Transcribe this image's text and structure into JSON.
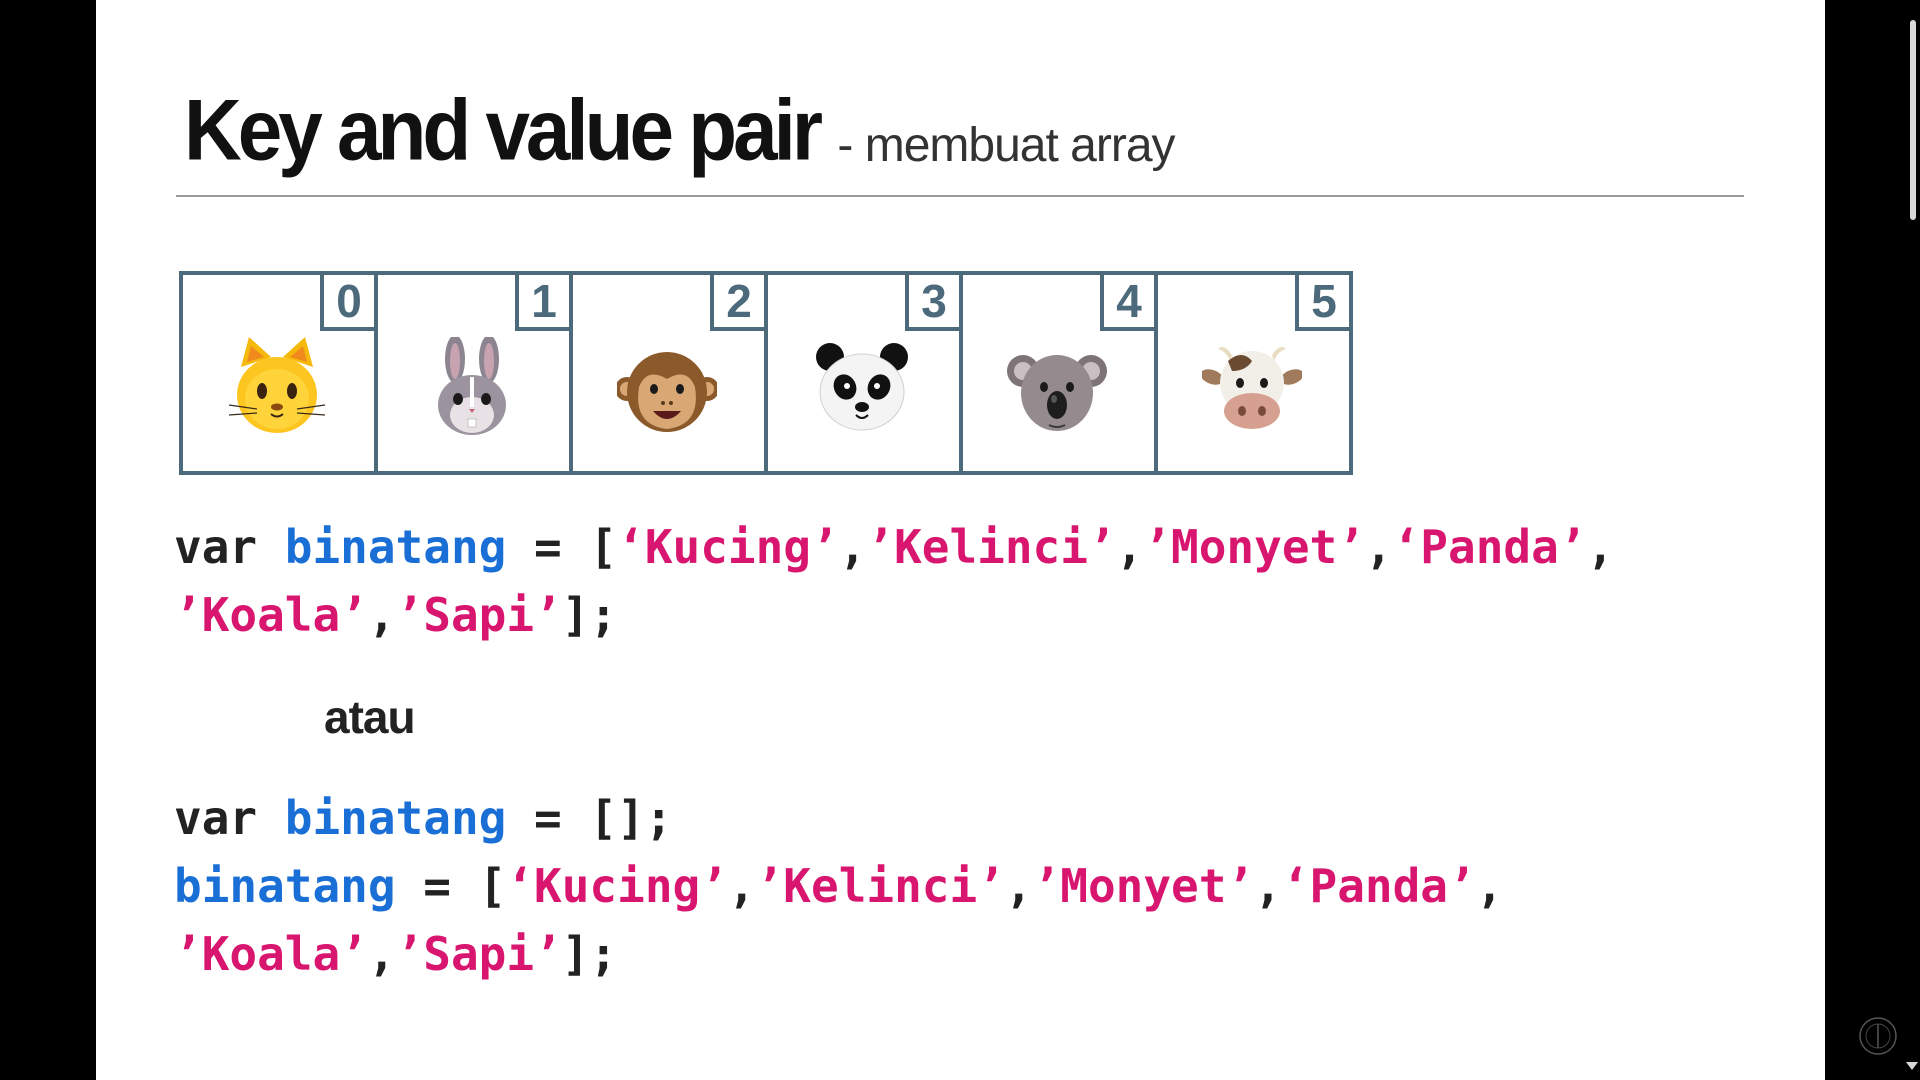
{
  "slide": {
    "title": "Key and value pair",
    "subtitle": "- membuat array"
  },
  "array_cells": [
    {
      "index": "0",
      "icon": "cat-face-icon"
    },
    {
      "index": "1",
      "icon": "rabbit-face-icon"
    },
    {
      "index": "2",
      "icon": "monkey-face-icon"
    },
    {
      "index": "3",
      "icon": "panda-face-icon"
    },
    {
      "index": "4",
      "icon": "koala-face-icon"
    },
    {
      "index": "5",
      "icon": "cow-face-icon"
    }
  ],
  "code_block_1": {
    "line1": {
      "kw": "var ",
      "ident": "binatang",
      "op": " = [",
      "s1": "‘Kucing’",
      "c1": ",",
      "s2": "’Kelinci’",
      "c2": ",",
      "s3": "’Monyet’",
      "c3": ",",
      "s4": "‘Panda’",
      "c4": ","
    },
    "line2": {
      "s5": "’Koala’",
      "c5": ",",
      "s6": "’Sapi’",
      "end": "];"
    }
  },
  "separator": "atau",
  "code_block_2": {
    "line1": {
      "kw": "var ",
      "ident": "binatang",
      "op": " = [];"
    },
    "line2": {
      "ident": "binatang",
      "op": " = [",
      "s1": "‘Kucing’",
      "c1": ",",
      "s2": "’Kelinci’",
      "c2": ",",
      "s3": "’Monyet’",
      "c3": ",",
      "s4": "‘Panda’",
      "c4": ","
    },
    "line3": {
      "s5": "’Koala’",
      "c5": ",",
      "s6": "’Sapi’",
      "end": "];"
    }
  },
  "colors": {
    "keyword": "#222222",
    "identifier": "#1a6fd6",
    "string": "#d9166f",
    "array_border": "#4d6a7c"
  }
}
